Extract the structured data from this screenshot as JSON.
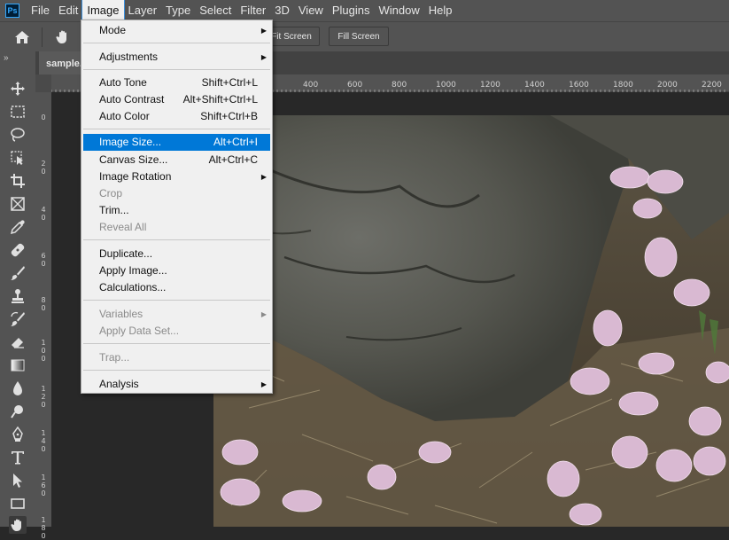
{
  "menubar": {
    "logo": "Ps",
    "items": [
      "File",
      "Edit",
      "Image",
      "Layer",
      "Type",
      "Select",
      "Filter",
      "3D",
      "View",
      "Plugins",
      "Window",
      "Help"
    ],
    "active": "Image"
  },
  "options": {
    "fit_screen": "Fit Screen",
    "fill_screen": "Fill Screen"
  },
  "document": {
    "tab": "sample."
  },
  "ruler": {
    "top_ticks": [
      "400",
      "600",
      "800",
      "1000",
      "1200",
      "1400",
      "1600",
      "1800",
      "2000",
      "2200"
    ],
    "left_ticks": [
      "0",
      "2\n0",
      "4\n0",
      "6\n0",
      "8\n0",
      "1\n0\n0",
      "1\n2\n0",
      "1\n4\n0",
      "1\n6\n0",
      "1\n8\n0"
    ]
  },
  "image_menu": {
    "mode": "Mode",
    "adjustments": "Adjustments",
    "auto_tone": "Auto Tone",
    "auto_tone_sc": "Shift+Ctrl+L",
    "auto_contrast": "Auto Contrast",
    "auto_contrast_sc": "Alt+Shift+Ctrl+L",
    "auto_color": "Auto Color",
    "auto_color_sc": "Shift+Ctrl+B",
    "image_size": "Image Size...",
    "image_size_sc": "Alt+Ctrl+I",
    "canvas_size": "Canvas Size...",
    "canvas_size_sc": "Alt+Ctrl+C",
    "image_rotation": "Image Rotation",
    "crop": "Crop",
    "trim": "Trim...",
    "reveal_all": "Reveal All",
    "duplicate": "Duplicate...",
    "apply_image": "Apply Image...",
    "calculations": "Calculations...",
    "variables": "Variables",
    "apply_data_set": "Apply Data Set...",
    "trap": "Trap...",
    "analysis": "Analysis"
  },
  "colors": {
    "highlight": "#0078d7",
    "ps_blue": "#31a8ff"
  }
}
